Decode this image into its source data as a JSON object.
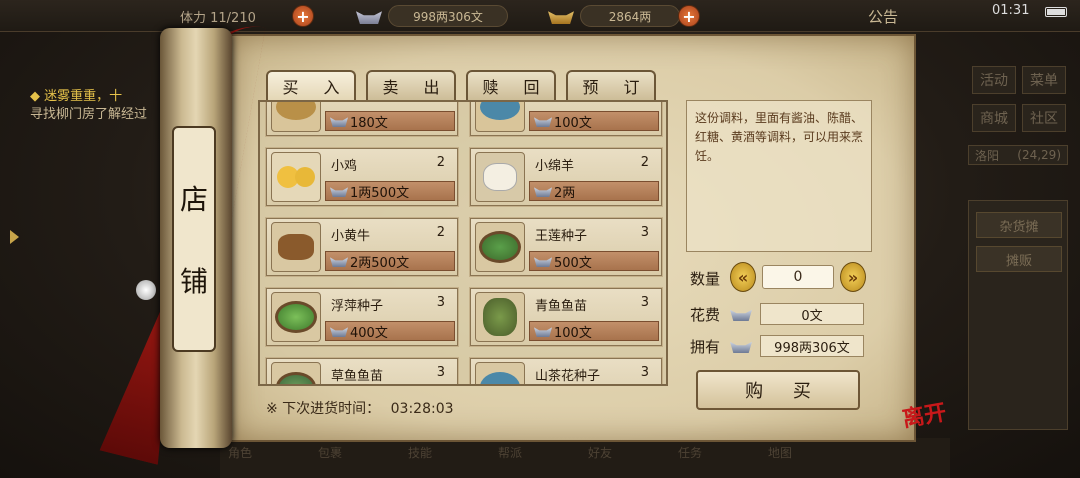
{
  "topbar": {
    "stamina": "体力 11/210",
    "silver": "998两306文",
    "gold": "2864两",
    "notice": "公告",
    "time": "01:31"
  },
  "quest": {
    "title": "◆ 迷雾重重，十",
    "body": "寻找柳门房了解经过"
  },
  "right_menu": {
    "activity": "活动",
    "menu": "菜单",
    "mall": "商城",
    "community": "社区",
    "location": "洛阳",
    "coords": "(24,29)",
    "stall_market": "杂货摊",
    "vendor": "摊贩"
  },
  "shop": {
    "scroll_title_1": "店",
    "scroll_title_2": "铺",
    "tabs": [
      "买 入",
      "卖 出",
      "赎 回",
      "预 订"
    ],
    "items": [
      {
        "name": "",
        "qty": "",
        "price": "180文"
      },
      {
        "name": "",
        "qty": "",
        "price": "100文"
      },
      {
        "name": "小鸡",
        "qty": "2",
        "price": "1两500文"
      },
      {
        "name": "小绵羊",
        "qty": "2",
        "price": "2两"
      },
      {
        "name": "小黄牛",
        "qty": "2",
        "price": "2两500文"
      },
      {
        "name": "王莲种子",
        "qty": "3",
        "price": "500文"
      },
      {
        "name": "浮萍种子",
        "qty": "3",
        "price": "400文"
      },
      {
        "name": "青鱼鱼苗",
        "qty": "3",
        "price": "100文"
      },
      {
        "name": "草鱼鱼苗",
        "qty": "3",
        "price": ""
      },
      {
        "name": "山茶花种子",
        "qty": "3",
        "price": ""
      }
    ],
    "restock_label": "※ 下次进货时间：",
    "restock_time": "03:28:03",
    "description": "这份调料，里面有酱油、陈醋、红糖、黄酒等调料，可以用来烹饪。",
    "qty_label": "数量",
    "qty_value": "0",
    "cost_label": "花费",
    "cost_value": "0文",
    "own_label": "拥有",
    "own_value": "998两306文",
    "buy_label": "购 买",
    "leave_label": "离开"
  },
  "dock": [
    "角色",
    "包裹",
    "技能",
    "帮派",
    "好友",
    "任务",
    "地图"
  ]
}
